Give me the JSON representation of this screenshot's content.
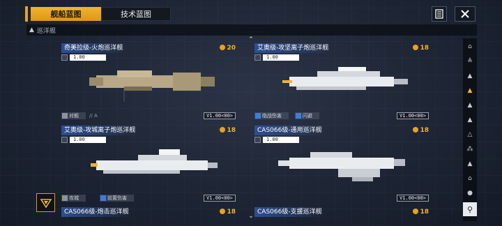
{
  "tabs": [
    {
      "label": "舰船蓝图",
      "active": true
    },
    {
      "label": "技术蓝图",
      "active": false
    }
  ],
  "section": {
    "title": "巡洋舰"
  },
  "cards": [
    {
      "title": "奇美拉级-火炮巡洋舰",
      "cost": "20",
      "stat": "1.00",
      "tags": [
        "对舰",
        "// A"
      ],
      "tag_colors": [
        "grey",
        "none"
      ],
      "version": "V1.00<00>",
      "hull": "tan"
    },
    {
      "title": "艾奥级-攻坚离子炮巡洋舰",
      "cost": "18",
      "stat": "1.00",
      "tags": [
        "临战伤害",
        "闪避"
      ],
      "tag_colors": [
        "blue",
        "blue"
      ],
      "version": "V1.00<00>",
      "hull": "white"
    },
    {
      "title": "艾奥级-攻城离子炮巡洋舰",
      "cost": "18",
      "stat": "1.00",
      "tags": [
        "攻城",
        "前置伤害"
      ],
      "tag_colors": [
        "grey",
        "blue"
      ],
      "version": "V1.00<00>",
      "hull": "white"
    },
    {
      "title": "CAS066级-通用巡洋舰",
      "cost": "18",
      "stat": "1.00",
      "tags": [],
      "tag_colors": [],
      "version": "V1.00<00>",
      "hull": "white"
    },
    {
      "title": "CAS066级-炮击巡洋舰",
      "cost": "18",
      "stat": "",
      "tags": [],
      "tag_colors": [],
      "version": "",
      "hull": "none"
    },
    {
      "title": "CAS066级-支援巡洋舰",
      "cost": "18",
      "stat": "",
      "tags": [],
      "tag_colors": [],
      "version": "",
      "hull": "none"
    }
  ],
  "colors": {
    "accent": "#f2b42c",
    "title_blue": "#2d4f92",
    "hull_white": "#e9ecef",
    "hull_tan": "#b8a886"
  },
  "icons": {
    "doc": "document-icon",
    "close": "close-icon",
    "filter": "filter-icon"
  }
}
